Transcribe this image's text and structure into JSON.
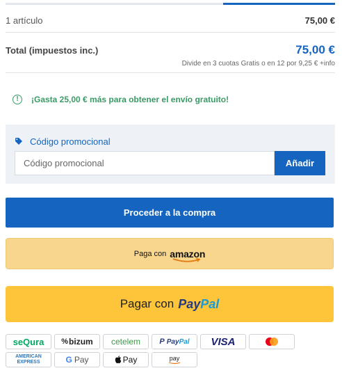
{
  "progress": {
    "fraction": 0.66
  },
  "summary": {
    "items_label": "1 artículo",
    "items_value": "75,00 €",
    "total_label": "Total (impuestos inc.)",
    "total_value": "75,00 €",
    "installments_text": "Divide en 3 cuotas Gratis o en 12 por 9,25 € +info"
  },
  "shipping": {
    "icon": "info-icon",
    "message": "¡Gasta 25,00 € más para obtener el envío gratuito!"
  },
  "promo": {
    "title": "Código promocional",
    "input_placeholder": "Código promocional",
    "input_value": "",
    "apply_label": "Añadir"
  },
  "checkout": {
    "proceed_label": "Proceder a la compra"
  },
  "amazon": {
    "prefix": "Paga con",
    "brand": "amazon"
  },
  "paypal": {
    "prefix": "Pagar con",
    "brand_pay": "Pay",
    "brand_pal": "Pal"
  },
  "payment_methods": {
    "sequra": "seQura",
    "bizum": "bizum",
    "cetelem": "cetelem",
    "paypal_pay": "Pay",
    "paypal_pal": "Pal",
    "visa": "VISA",
    "amex_line1": "AMERICAN",
    "amex_line2": "EXPRESS",
    "gpay_g": "G",
    "gpay_text": "Pay",
    "applepay_text": "Pay",
    "amazonpay_text": "pay"
  },
  "colors": {
    "primary": "#1565c0",
    "success": "#3a9b67",
    "amazon_bg": "#f8d68d",
    "paypal_bg": "#fec43a",
    "promo_bg": "#eef2f6"
  }
}
